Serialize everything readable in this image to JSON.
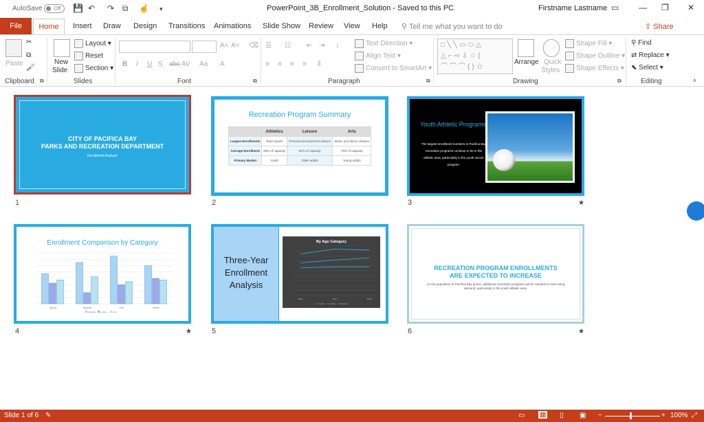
{
  "titlebar": {
    "autosave": "AutoSave",
    "toggle": "Off",
    "doc_title": "PowerPoint_3B_Enrollment_Solution  -  Saved to this PC",
    "user": "Firstname Lastname"
  },
  "tabs": {
    "file": "File",
    "home": "Home",
    "items": [
      "Insert",
      "Draw",
      "Design",
      "Transitions",
      "Animations",
      "Slide Show",
      "Review",
      "View",
      "Help"
    ],
    "tell_me": "Tell me what you want to do",
    "share": "Share"
  },
  "ribbon": {
    "clipboard": {
      "paste": "Paste",
      "label": "Clipboard"
    },
    "slides": {
      "new_slide_1": "New",
      "new_slide_2": "Slide",
      "layout": "Layout",
      "reset": "Reset",
      "section": "Section",
      "label": "Slides"
    },
    "font": {
      "label": "Font"
    },
    "paragraph": {
      "text_direction": "Text Direction",
      "align_text": "Align Text",
      "convert": "Convert to SmartArt",
      "label": "Paragraph"
    },
    "drawing": {
      "arrange": "Arrange",
      "quick_styles_1": "Quick",
      "quick_styles_2": "Styles",
      "shape_fill": "Shape Fill",
      "shape_outline": "Shape Outline",
      "shape_effects": "Shape Effects",
      "label": "Drawing"
    },
    "editing": {
      "find": "Find",
      "replace": "Replace",
      "select": "Select",
      "label": "Editing"
    }
  },
  "slides": [
    {
      "num": "1",
      "line1": "CITY OF PACIFICA BAY",
      "line2": "PARKS AND RECREATION DEPARTMENT",
      "sub": "Enrollment Analysis"
    },
    {
      "num": "2",
      "title": "Recreation Program Summary",
      "headers": [
        "",
        "Athletics",
        "Leisure",
        "Arts"
      ],
      "rows": [
        [
          "Largest Enrollments",
          "Team sports",
          "Personal development classes",
          "Music and dance classes"
        ],
        [
          "Average Enrollment",
          "85% of capacity",
          "64% of capacity",
          "78% of capacity"
        ],
        [
          "Primary Market",
          "Youth",
          "Older adults",
          "Young adults"
        ]
      ]
    },
    {
      "num": "3",
      "title": "Youth Athletic Programs",
      "body": "The largest enrollment numbers in Pacifica Bay recreation programs continue to be in the athletic area, particularly in the youth soccer program."
    },
    {
      "num": "4",
      "title": "Enrollment Comparison by Category"
    },
    {
      "num": "5",
      "title": "Three-Year Enrollment Analysis",
      "chart_title": "By Age Category"
    },
    {
      "num": "6",
      "line1": "RECREATION PROGRAM ENROLLMENTS",
      "line2": "ARE EXPECTED TO INCREASE",
      "body": "As the population of Pacifica Bay grows, additional recreation programs will be needed to meet rising demand, particularly in the youth athletic area."
    }
  ],
  "chart_data": [
    {
      "type": "bar",
      "title": "Enrollment Comparison by Category",
      "categories": [
        "Spring",
        "Summer",
        "Fall",
        "Winter"
      ],
      "series": [
        {
          "name": "Athletics",
          "values": [
            95,
            130,
            150,
            120
          ]
        },
        {
          "name": "Leisure",
          "values": [
            65,
            35,
            60,
            80
          ]
        },
        {
          "name": "Arts",
          "values": [
            75,
            85,
            70,
            75
          ]
        }
      ],
      "ylim": [
        0,
        160
      ],
      "colors": [
        "#a8d4f5",
        "#9fa8e8",
        "#b7e3f0"
      ]
    },
    {
      "type": "line",
      "title": "By Age Category",
      "categories": [
        "2016",
        "2017",
        "2018"
      ],
      "series": [
        {
          "name": "Youth",
          "values": [
            4200,
            4700,
            4600
          ]
        },
        {
          "name": "Adults",
          "values": [
            3300,
            3600,
            3800
          ]
        },
        {
          "name": "Seniors",
          "values": [
            2800,
            2900,
            2900
          ]
        }
      ],
      "ylim": [
        0,
        5000
      ],
      "colors": [
        "#29abe2",
        "#29abe2",
        "#29abe2"
      ]
    }
  ],
  "status": {
    "slide_info": "Slide 1 of 6",
    "zoom": "100%"
  }
}
